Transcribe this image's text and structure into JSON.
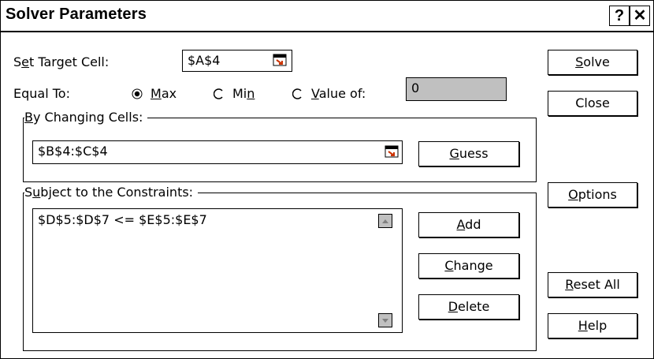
{
  "window": {
    "title": "Solver Parameters",
    "help_glyph": "?",
    "close_glyph": "✕"
  },
  "target": {
    "label_pre": "S",
    "label_key": "e",
    "label_post": "t Target Cell:",
    "value": "$A$4"
  },
  "equal_to": {
    "label": "Equal To:",
    "options": [
      {
        "key": "M",
        "rest": "ax",
        "checked": true
      },
      {
        "pre": "Mi",
        "key": "n",
        "rest": "",
        "checked": false
      },
      {
        "key": "V",
        "rest": "alue of:",
        "checked": false
      }
    ],
    "value_of": "0"
  },
  "changing": {
    "legend_key": "B",
    "legend_rest": "y Changing Cells:",
    "value": "$B$4:$C$4",
    "guess_key": "G",
    "guess_rest": "uess"
  },
  "constraints": {
    "legend_pre": "S",
    "legend_key": "u",
    "legend_rest": "bject to the Constraints:",
    "items": [
      "$D$5:$D$7 <= $E$5:$E$7"
    ],
    "add_key": "A",
    "add_rest": "dd",
    "change_key": "C",
    "change_rest": "hange",
    "delete_key": "D",
    "delete_rest": "elete"
  },
  "side_buttons": {
    "solve_key": "S",
    "solve_rest": "olve",
    "close": "Close",
    "options_key": "O",
    "options_rest": "ptions",
    "reset_key": "R",
    "reset_rest": "eset All",
    "help_key": "H",
    "help_rest": "elp"
  },
  "colors": {
    "disabled_field": "#c0c0c0",
    "ref_icon_accent": "#cc3300"
  }
}
